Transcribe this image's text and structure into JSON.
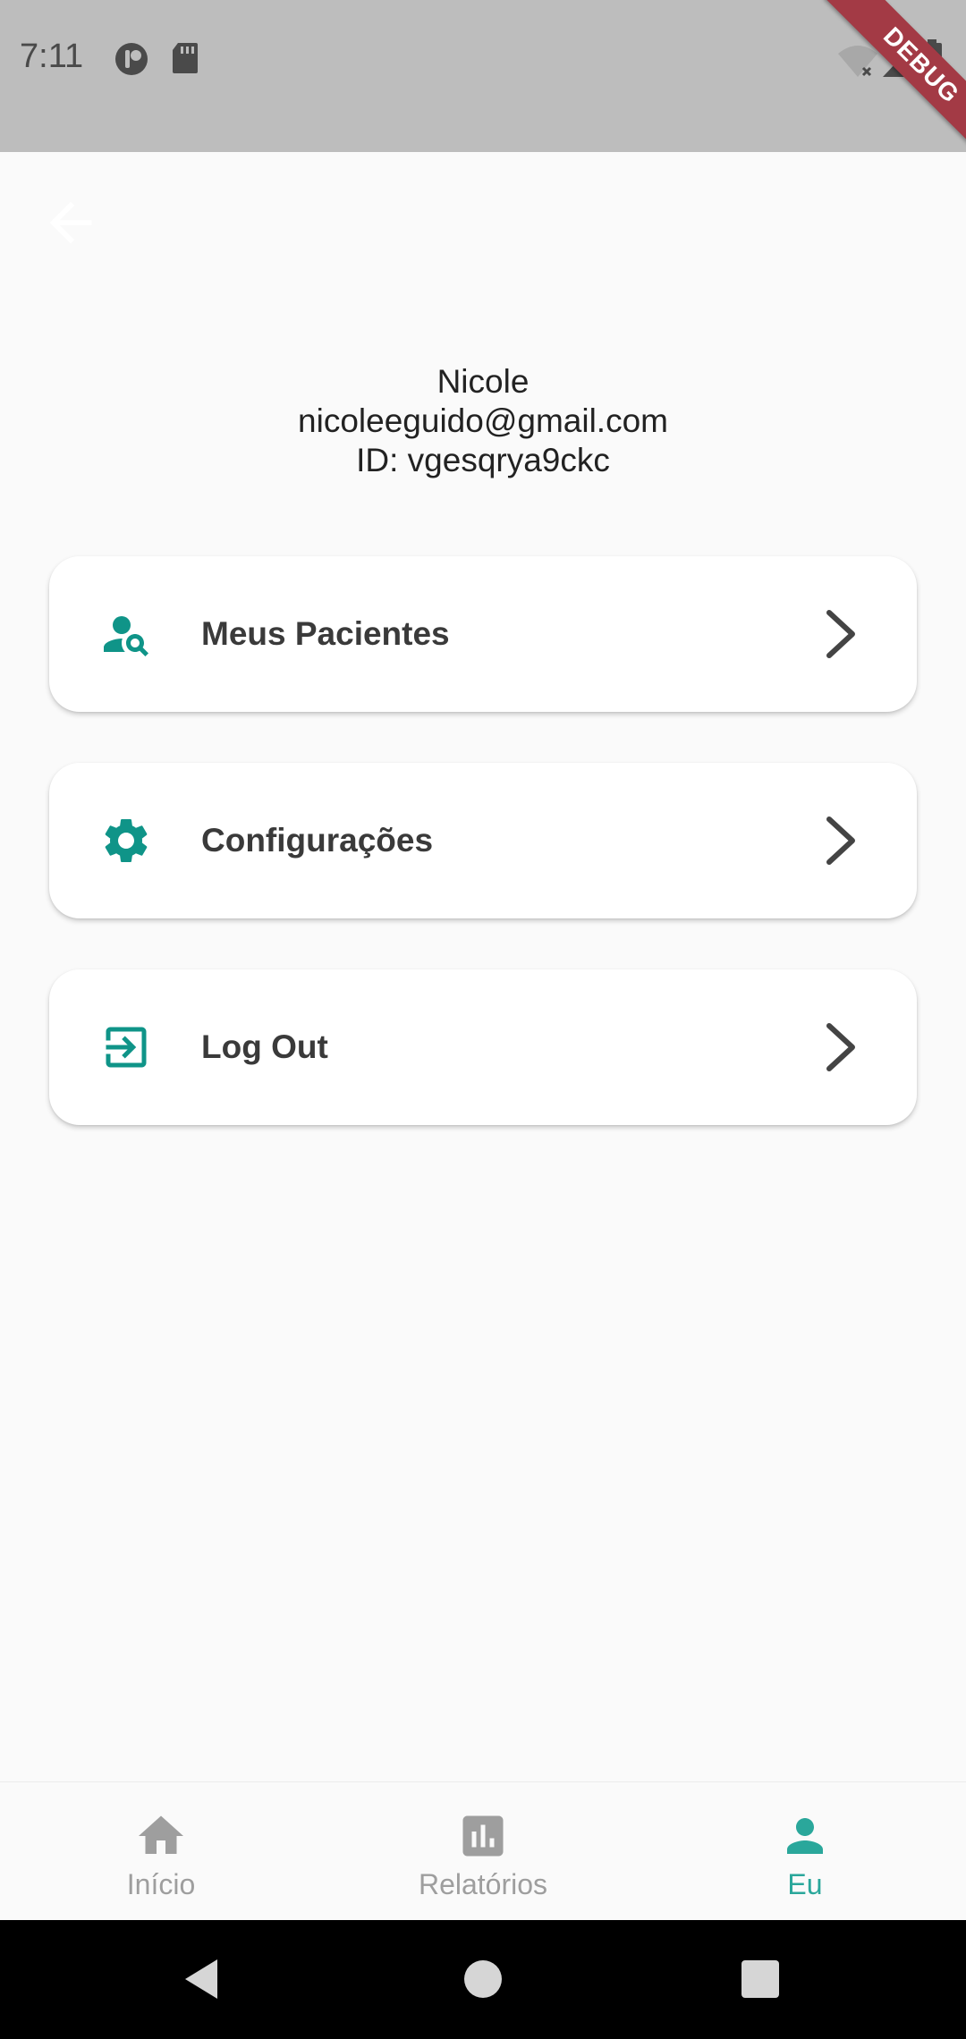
{
  "status_bar": {
    "time": "7:11",
    "debug_label": "DEBUG"
  },
  "app_bar": {
    "back_icon": "arrow-left-icon"
  },
  "profile": {
    "name": "Nicole",
    "email": "nicoleeguido@gmail.com",
    "id_text": "ID: vgesqrya9ckc"
  },
  "menu": {
    "items": [
      {
        "label": "Meus Pacientes",
        "icon": "person-search-icon"
      },
      {
        "label": "Configurações",
        "icon": "gear-icon"
      },
      {
        "label": "Log Out",
        "icon": "login-icon"
      }
    ]
  },
  "bottom_nav": {
    "items": [
      {
        "label": "Início",
        "icon": "home-icon",
        "active": false
      },
      {
        "label": "Relatórios",
        "icon": "bar-chart-icon",
        "active": false
      },
      {
        "label": "Eu",
        "icon": "person-icon",
        "active": true
      }
    ]
  },
  "colors": {
    "accent": "#2aa79b",
    "icon_teal": "#0f9488",
    "inactive": "#9e9e9e",
    "status_bar": "#bdbdbd",
    "debug_ribbon": "#a33a45"
  }
}
